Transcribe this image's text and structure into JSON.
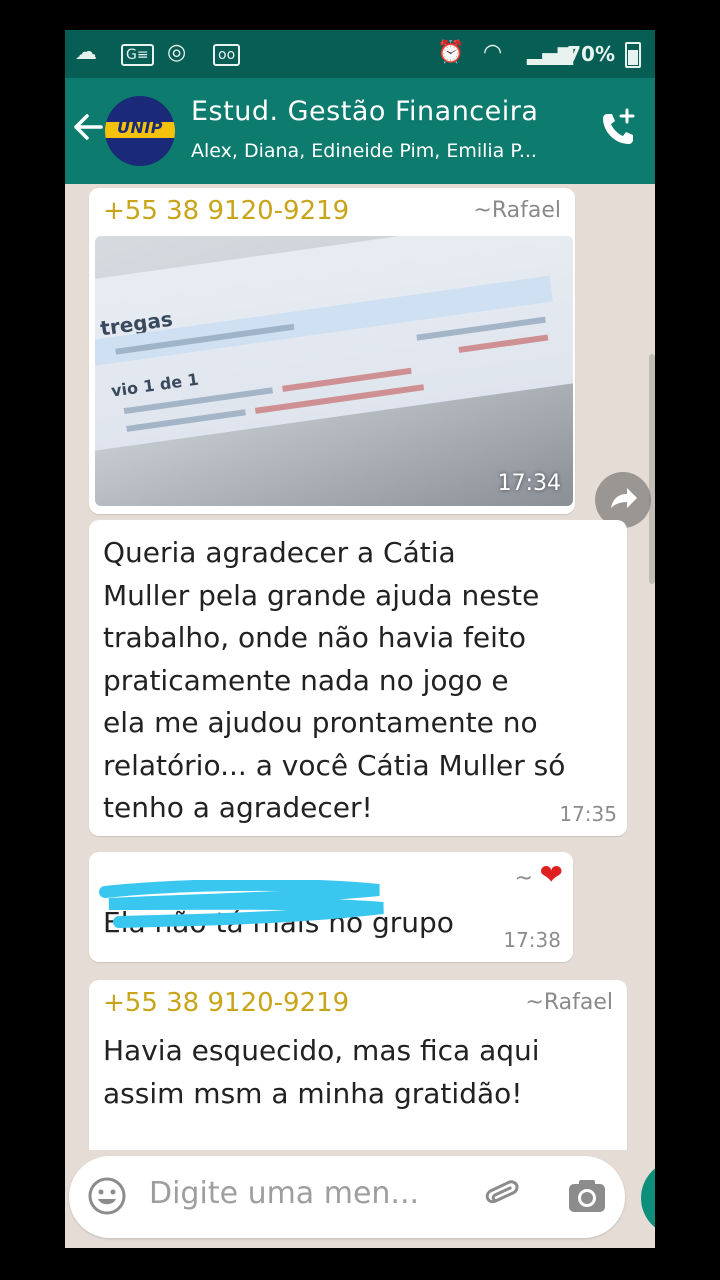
{
  "status_bar": {
    "battery": "70%"
  },
  "header": {
    "logo": "UNIP",
    "title": "Estud. Gestão Financeira",
    "participants": "Alex, Diana, Edineide Pim, Emilia P..."
  },
  "messages": [
    {
      "sender": "+55 38 9120-9219",
      "alias": "~Rafael",
      "type": "image",
      "time": "17:34"
    },
    {
      "type": "text",
      "text": "Queria agradecer a Cátia\nMuller pela grande ajuda neste\ntrabalho, onde não havia feito\npraticamente nada no jogo e\nela me ajudou prontamente no\nrelatório... a você Cátia Muller só\ntenho a agradecer!",
      "time": "17:35"
    },
    {
      "sender_alias_prefix": "~",
      "sender_alias_emoji": "❤",
      "type": "text",
      "text": "Ela não tá mais no grupo",
      "time": "17:38"
    },
    {
      "sender": "+55 38 9120-9219",
      "alias": "~Rafael",
      "type": "text",
      "text": "Havia esquecido, mas fica aqui\nassim msm a minha gratidão!"
    }
  ],
  "image_text": {
    "heading": "tregas",
    "row_label": "vio 1 de 1"
  },
  "input": {
    "placeholder": "Digite uma men..."
  },
  "icons": {
    "back": "arrow-left-icon",
    "call": "add-call-icon",
    "forward": "forward-icon",
    "emoji": "emoji-icon",
    "attach": "paperclip-icon",
    "camera": "camera-icon"
  },
  "colors": {
    "header": "#0d7b6d",
    "status_bar": "#075e54",
    "chat_bg": "#e5ddd5",
    "sender_name": "#c9a418",
    "accent_redact": "#39c7f0"
  }
}
